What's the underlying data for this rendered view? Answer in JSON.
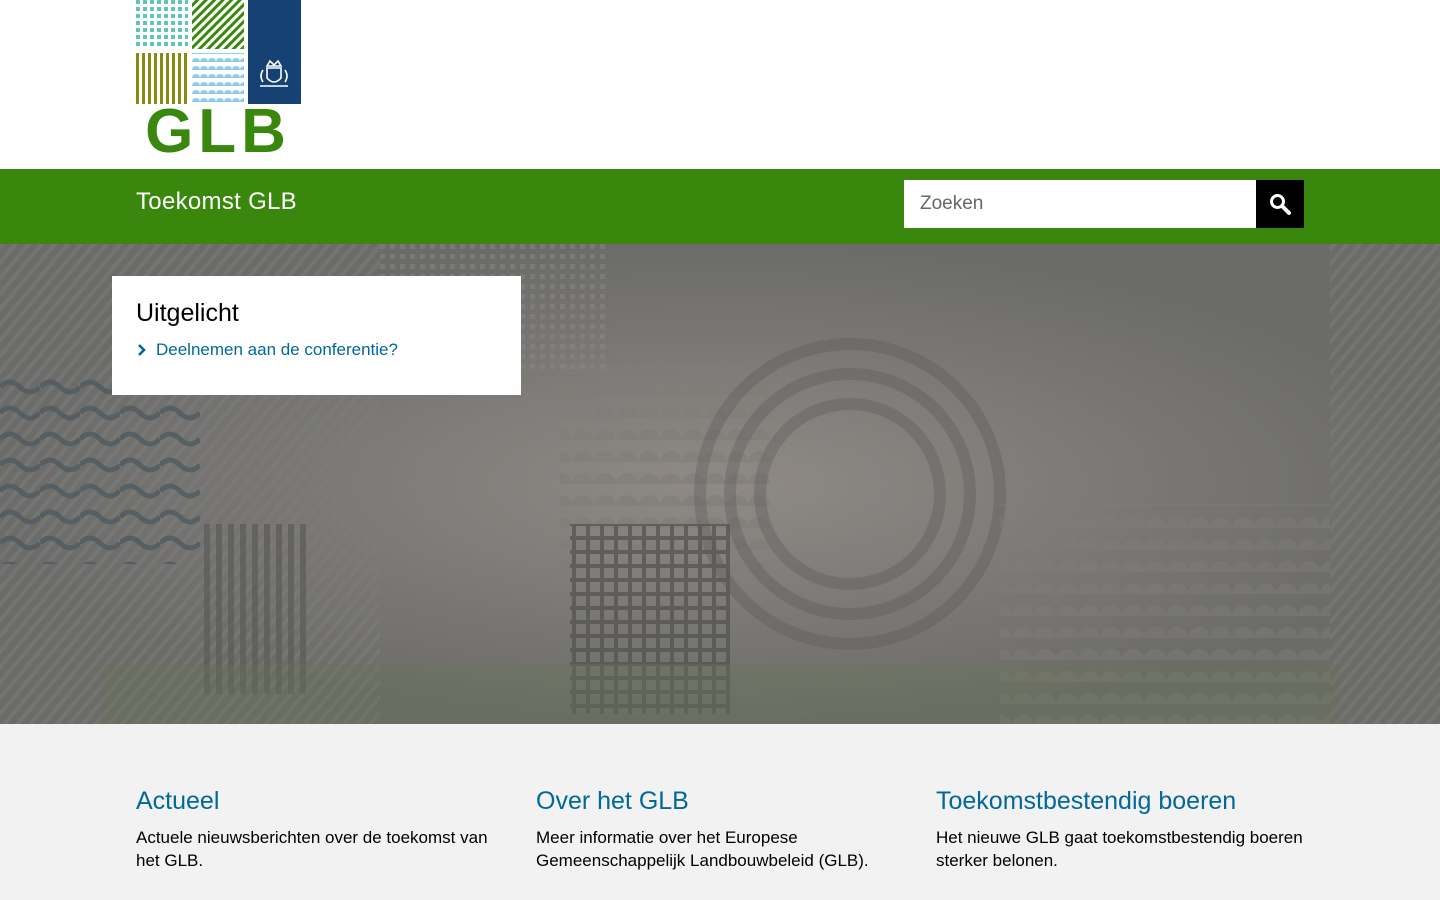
{
  "logo": {
    "text": "GLB",
    "colors": {
      "teal": "#5ec6b8",
      "green": "#39870c",
      "olive": "#8a8a12",
      "lightblue": "#8fcae7",
      "navy": "#154273"
    },
    "icon": "rijksoverheid-crest-icon"
  },
  "nav": {
    "site_title": "Toekomst GLB",
    "background": "#39870c"
  },
  "search": {
    "placeholder": "Zoeken",
    "value": "",
    "button_icon": "search-icon"
  },
  "featured": {
    "title": "Uitgelicht",
    "items": [
      {
        "label": "Deelnemen aan de conferentie?",
        "icon": "chevron-right-icon"
      }
    ]
  },
  "sections": [
    {
      "title": "Actueel",
      "text": "Actuele nieuwsberichten over de toekomst van het GLB."
    },
    {
      "title": "Over het GLB",
      "text": "Meer informatie over het Europese Gemeenschappelijk Landbouwbeleid (GLB)."
    },
    {
      "title": "Toekomstbestendig boeren",
      "text": "Het nieuwe GLB gaat toekomstbestendig boeren sterker belonen."
    }
  ],
  "colors": {
    "link": "#01689b",
    "bottom_bg": "#f2f2f2"
  }
}
